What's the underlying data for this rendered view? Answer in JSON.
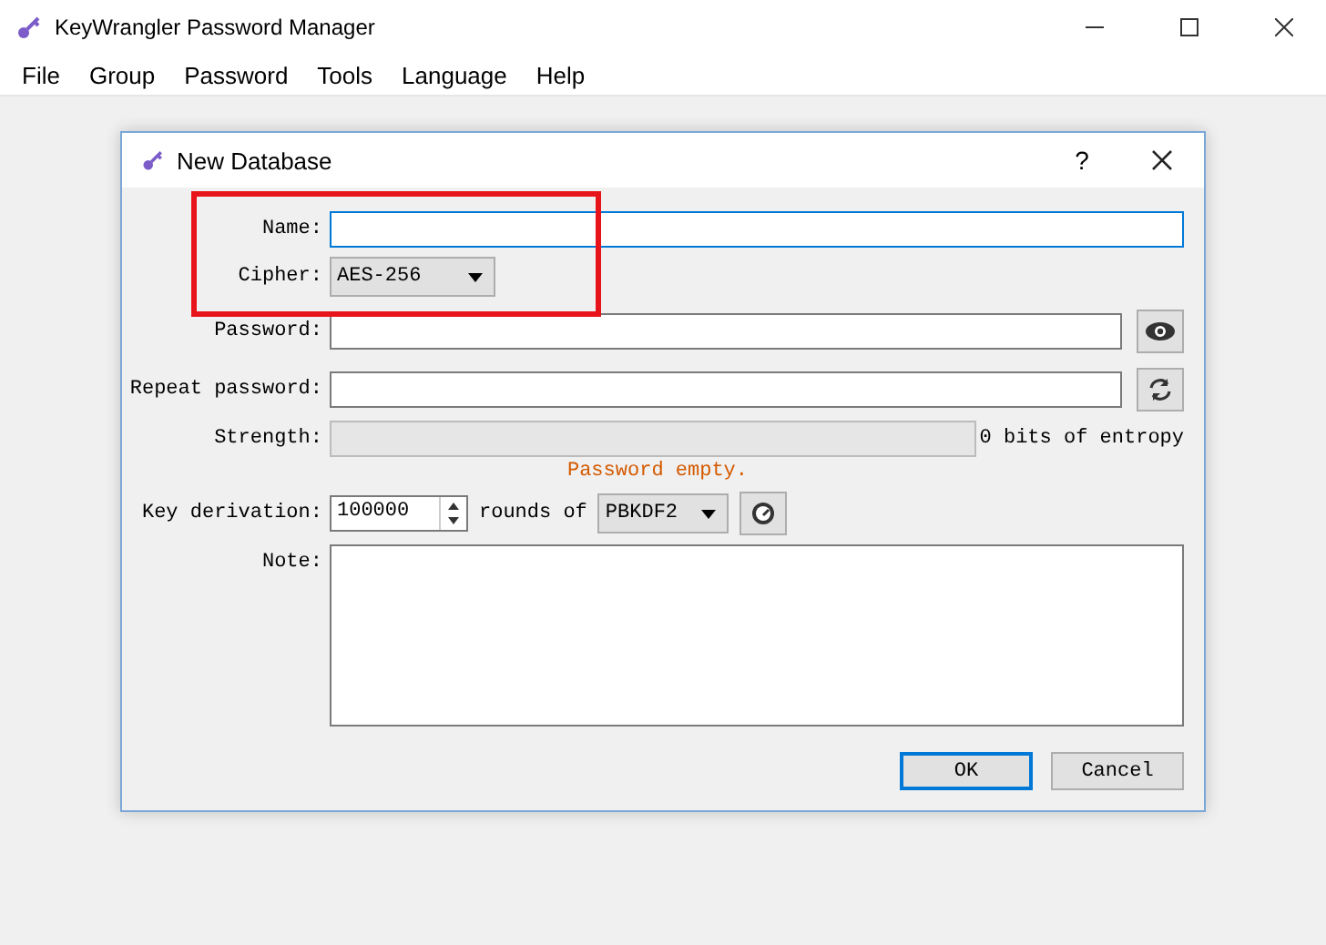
{
  "window": {
    "title": "KeyWrangler Password Manager"
  },
  "menu": [
    "File",
    "Group",
    "Password",
    "Tools",
    "Language",
    "Help"
  ],
  "dialog": {
    "title": "New Database",
    "help": "?",
    "fields": {
      "name": {
        "label": "Name:",
        "focused": true
      },
      "cipher": {
        "label": "Cipher:",
        "value": "AES-256"
      },
      "password": {
        "label": "Password:"
      },
      "repeat": {
        "label": "Repeat password:"
      },
      "strength": {
        "label": "Strength:",
        "level": 0,
        "reading": "0 bits of entropy",
        "message": "Password empty."
      },
      "key_derivation": {
        "label": "Key derivation:",
        "rounds": "100000",
        "between": "rounds of",
        "algorithm": "PBKDF2"
      },
      "note": {
        "label": "Note:"
      }
    },
    "buttons": [
      {
        "label": "OK",
        "default": true
      },
      {
        "label": "Cancel",
        "default": false
      }
    ]
  }
}
